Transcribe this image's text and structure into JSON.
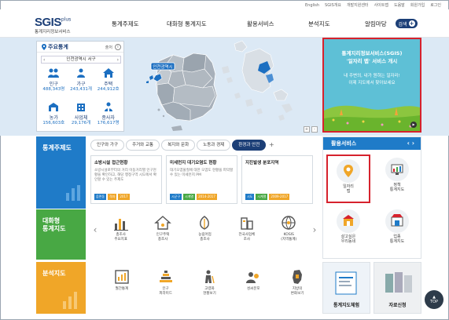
{
  "util_links": [
    "English",
    "SGIS개요",
    "개발지원센터",
    "사이트맵",
    "도움말",
    "회원가입",
    "로그인"
  ],
  "header": {
    "logo_main": "SGIS",
    "logo_plus": "plus",
    "logo_sub": "통계지리정보서비스",
    "nav": [
      "통계주제도",
      "대화형 통계지도",
      "활용서비스",
      "분석지도",
      "알림마당"
    ],
    "search_label": "검색"
  },
  "stats_panel": {
    "title": "주요통계",
    "source": "출처",
    "info": "i",
    "region": "인천광역시 서구",
    "prev": "‹",
    "next": "›",
    "items": [
      {
        "label": "인구",
        "value": "488,343명",
        "icon": "population-icon"
      },
      {
        "label": "가구",
        "value": "243,431개",
        "icon": "household-icon"
      },
      {
        "label": "주택",
        "value": "244,912호",
        "icon": "housing-icon"
      },
      {
        "label": "농가",
        "value": "156,603호",
        "icon": "farm-icon"
      },
      {
        "label": "사업체",
        "value": "29,176개",
        "icon": "business-icon"
      },
      {
        "label": "종사자",
        "value": "176,617명",
        "icon": "worker-icon"
      }
    ]
  },
  "map": {
    "label": "인천광역시",
    "zoom_in": "+",
    "zoom_out": "-"
  },
  "banner": {
    "line1": "통계지리정보서비스(SGIS)",
    "line2": "'일자리 맵' 서비스 개시",
    "line3": "내 주변의, 내가 원하는 일자리!",
    "line4": "이제 지도에서 찾아보세요",
    "pager": "▶"
  },
  "theme_section": {
    "title": "통계주제도",
    "tabs": [
      "인구와 가구",
      "주거와 교통",
      "복지와 문화",
      "노동과 경제",
      "환경과 안전"
    ],
    "active_tab": 4,
    "plus": "+",
    "cards": [
      {
        "title": "소방시설 접근현황",
        "desc": "소방시설로부터의 거리 이동거리별 인구현황을 확인하고, 해당 행정구역 시도에서 확인할 수 있는 주제도",
        "tags": [
          "읍면동",
          "격자",
          "2017"
        ]
      },
      {
        "title": "미세먼지 대기오염도 현황",
        "desc": "대기오염물질에 대한 오염도 현황을 파악할 수 있는 미세먼지 PM",
        "tags": [
          "시군구",
          "시계열",
          "2014-2017"
        ]
      },
      {
        "title": "지진발생 분포지역",
        "desc": "",
        "tags": [
          "시도",
          "시계열",
          "2009-2017"
        ]
      }
    ]
  },
  "interactive_section": {
    "title": "대화형 통계지도",
    "title_line1": "대화형",
    "title_line2": "통계지도",
    "prev": "‹",
    "next": "›",
    "items": [
      {
        "line1": "총조사",
        "line2": "주요지표"
      },
      {
        "line1": "인구주택",
        "line2": "총조사"
      },
      {
        "line1": "농림어업",
        "line2": "총조사"
      },
      {
        "line1": "전국사업체",
        "line2": "조사"
      },
      {
        "line1": "KOSIS",
        "line2": "(지역통계)"
      }
    ]
  },
  "analysis_section": {
    "title": "분석지도",
    "items": [
      {
        "line1": "월간통계",
        "line2": ""
      },
      {
        "line1": "인구",
        "line2": "피라미드"
      },
      {
        "line1": "고령화",
        "line2": "현황보기"
      },
      {
        "line1": "성씨분포",
        "line2": ""
      },
      {
        "line1": "지방의",
        "line2": "변화보기"
      }
    ]
  },
  "services": {
    "title": "활용서비스",
    "arrows": "‹ ›",
    "items": [
      {
        "line1": "일자리",
        "line2": "맵"
      },
      {
        "line1": "정책",
        "line2": "통계지도"
      },
      {
        "line1": "살고싶은",
        "line2": "우리동네"
      },
      {
        "line1": "업종",
        "line2": "통계지도"
      }
    ]
  },
  "bottom_tiles": [
    "통계지도체험",
    "자료신청"
  ],
  "top_button": "TOP",
  "colors": {
    "brand_navy": "#1c3f77",
    "theme_blue": "#1f7bc8",
    "interactive_green": "#48a844",
    "analysis_orange": "#f0a628",
    "highlight_red": "#d6222d"
  }
}
